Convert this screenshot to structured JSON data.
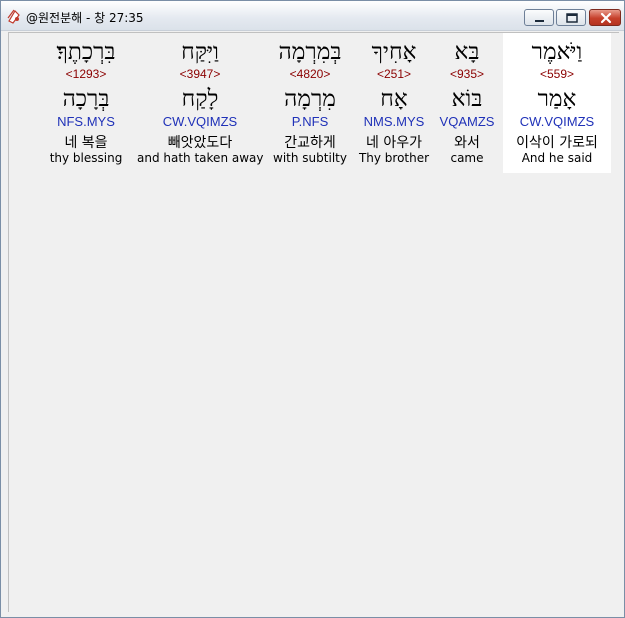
{
  "window": {
    "title": "@원전분해 - 창 27:35",
    "icon": "app-icon"
  },
  "words": [
    {
      "hebrew": "וַיֹּאמֶר",
      "strong": "<559>",
      "lemma": "אָמַר",
      "morph": "CW.VQIMZS",
      "korean": "이삭이 가로되",
      "english": "And he said",
      "selected": true
    },
    {
      "hebrew": "בָּא",
      "strong": "<935>",
      "lemma": "בּוֹא",
      "morph": "VQAMZS",
      "korean": "와서",
      "english": "came",
      "selected": false
    },
    {
      "hebrew": "אָחִיךָ",
      "strong": "<251>",
      "lemma": "אָח",
      "morph": "NMS.MYS",
      "korean": "네 아우가",
      "english": "Thy brother",
      "selected": false
    },
    {
      "hebrew": "בְּמִרְמָה",
      "strong": "<4820>",
      "lemma": "מִרְמָה",
      "morph": "P.NFS",
      "korean": "간교하게",
      "english": "with subtilty",
      "selected": false
    },
    {
      "hebrew": "וַיִּקַּח",
      "strong": "<3947>",
      "lemma": "לָקַח",
      "morph": "CW.VQIMZS",
      "korean": "빼앗았도다",
      "english": "and hath taken away",
      "selected": false
    },
    {
      "hebrew": "בִּרְכָתֶךָ׃",
      "strong": "<1293>",
      "lemma": "בְּרָכָה",
      "morph": "NFS.MYS",
      "korean": "네 복을",
      "english": "thy blessing",
      "selected": false
    }
  ]
}
